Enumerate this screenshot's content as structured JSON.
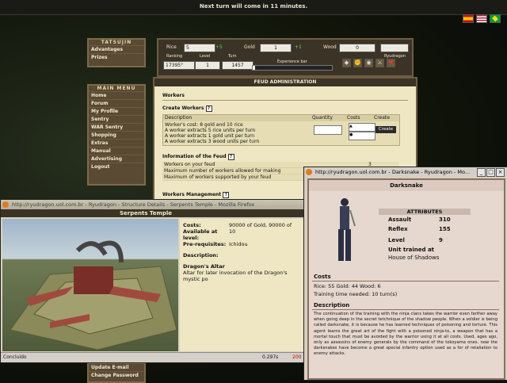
{
  "topbar": {
    "message": "Next turn will come in 11 minutes."
  },
  "left_menu": {
    "tatsujin_title": "TATSUJIN",
    "tatsujin_items": [
      "Advantages",
      "Prizes"
    ],
    "main_title": "MAIN MENU",
    "main_items": [
      "Home",
      "Forum",
      "My Profile",
      "Sentry",
      "WAR Sentry",
      "Shopping",
      "Extras",
      "Manual",
      "Advertising",
      "Logout"
    ],
    "bottom_items": [
      "Update E-mail",
      "Change Password"
    ]
  },
  "resources": {
    "rice_label": "Rice",
    "rice_value": "5",
    "rice_plus": "+5",
    "gold_label": "Gold",
    "gold_value": "1",
    "gold_plus": "+1",
    "wood_label": "Wood",
    "wood_value": "0",
    "brand": "Ryudragon",
    "ranking_label": "Ranking",
    "ranking_value": "17395°",
    "level_label": "Level",
    "level_value": "1",
    "turn_label": "Turn",
    "turn_value": "1457",
    "xp_label": "Experience bar",
    "xp_fraction": 0.03
  },
  "feud": {
    "title": "FEUD ADMINISTRATION",
    "workers_title": "Workers",
    "create_title": "Create Workers",
    "col_description": "Description",
    "col_quantity": "Quantity",
    "col_costs": "Costs",
    "col_create": "Create",
    "desc_lines": [
      "Worker's cost: 8 gold and 10 rice",
      "A worker extracts 5 rice units per turn",
      "A worker extracts 1 gold unit per turn",
      "A worker extracts 3 wood units per turn"
    ],
    "create_button": "Create",
    "info_title": "Information of the Feud",
    "info_rows": [
      {
        "label": "Workers on your feud",
        "value": "3"
      },
      {
        "label": "Maximum number of workers allowed for making",
        "value": ""
      },
      {
        "label": "Maximum of workers supported by your feud",
        "value": ""
      }
    ],
    "mgmt_title": "Workers Management"
  },
  "temple_window": {
    "title": "http://ryudragon.uol.com.br - Ryudragon - Structure Details - Serpents Temple - Mozilla Firefox",
    "heading": "Serpents Temple",
    "costs_label": "Costs:",
    "costs_value": "90000 of Gold, 90000 of",
    "available_label": "Available at level:",
    "available_value": "10",
    "prereq_label": "Pre-requisites:",
    "prereq_value": "Ichidou",
    "description_label": "Description:",
    "item_name": "Dragon's Altar",
    "item_text": "Altar for later invocation of the Dragon's mystic po",
    "status_left": "Concluído",
    "status_time": "0.297s",
    "status_extra": "200"
  },
  "darksnake_window": {
    "title": "http://ryudragon.uol.com.br - Darksnake - Ryudragon - Mo...",
    "heading": "Darksnake",
    "attributes_title": "ATTRIBUTES",
    "assault_label": "Assault",
    "assault_value": "310",
    "reflex_label": "Reflex",
    "reflex_value": "155",
    "level_label": "Level",
    "level_value": "9",
    "trained_label": "Unit trained at",
    "trained_value": "House of Shadows",
    "costs_title": "Costs",
    "costs_line": "Rice: 55  Gold: 44  Wood: 6",
    "training_line": "Training time needed: 10 turn(s)",
    "description_title": "Description",
    "description_text": "The continuation of the training with the ninja clans takes the warrior even farther away when going deep in the secret tetchnique of the shadow people. When a soldier is being called darksnake, it is because he has learned techniques of poisoning and torture. This agent learns the great art of the fight with a poisoned ninja-to, a weapon that has a mortal touch that must be avoided by the warrior using it at all costs. Used, ages ago, only as assassins of enemy generals by the command of the tokoyama ones. now the darksnakes have become a great special infantry option used as a for of retaliation to enemy attacks."
  },
  "colors": {
    "panel_dark": "#3b3326",
    "parchment": "#efe7c4",
    "green_plus": "#4fdf4f",
    "frame_wood": "#5a4a33"
  }
}
